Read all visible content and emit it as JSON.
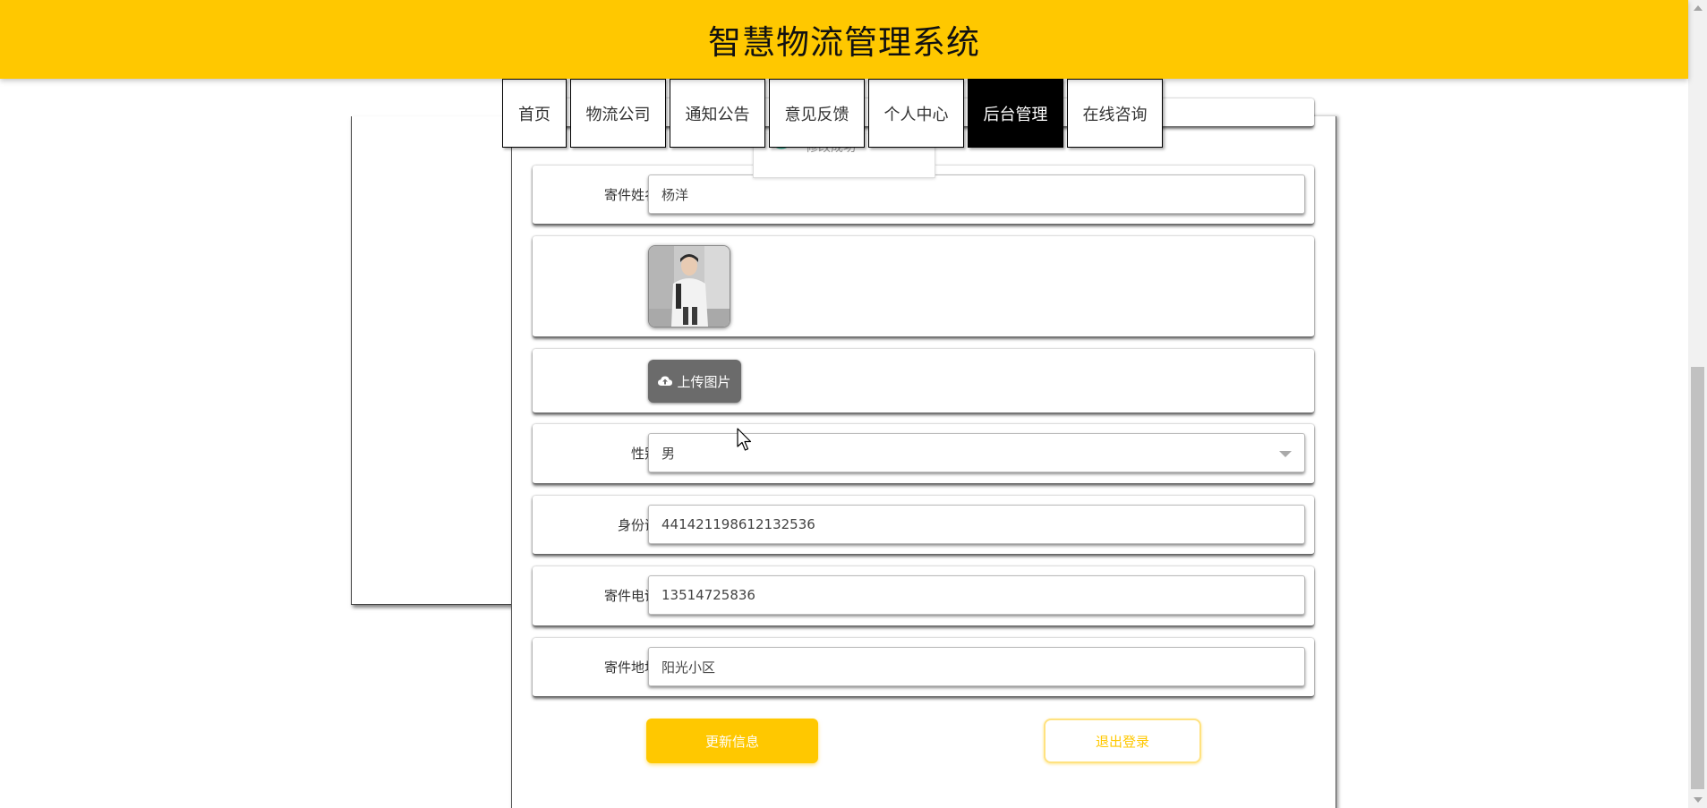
{
  "header": {
    "title": "智慧物流管理系统",
    "bg_color": "#ffc800"
  },
  "nav": {
    "items": [
      {
        "label": "首页",
        "active": false
      },
      {
        "label": "物流公司",
        "active": false
      },
      {
        "label": "通知公告",
        "active": false
      },
      {
        "label": "意见反馈",
        "active": false
      },
      {
        "label": "个人中心",
        "active": false
      },
      {
        "label": "后台管理",
        "active": true
      },
      {
        "label": "在线咨询",
        "active": false
      }
    ]
  },
  "toast": {
    "icon": "success-check-icon",
    "text": "修改成功"
  },
  "form": {
    "name": {
      "label": "寄件姓名",
      "value": "杨洋"
    },
    "avatar": {
      "icon": "user-photo"
    },
    "upload": {
      "label": "上传图片",
      "icon": "cloud-upload-icon"
    },
    "gender": {
      "label": "性别",
      "value": "男"
    },
    "id_card": {
      "label": "身份证",
      "value": "441421198612132536"
    },
    "phone": {
      "label": "寄件电话",
      "value": "13514725836"
    },
    "address": {
      "label": "寄件地址",
      "value": "阳光小区"
    }
  },
  "actions": {
    "update_label": "更新信息",
    "logout_label": "退出登录"
  },
  "colors": {
    "accent": "#ffc800",
    "active_nav": "#000000",
    "upload_btn": "#6b6b6b"
  }
}
